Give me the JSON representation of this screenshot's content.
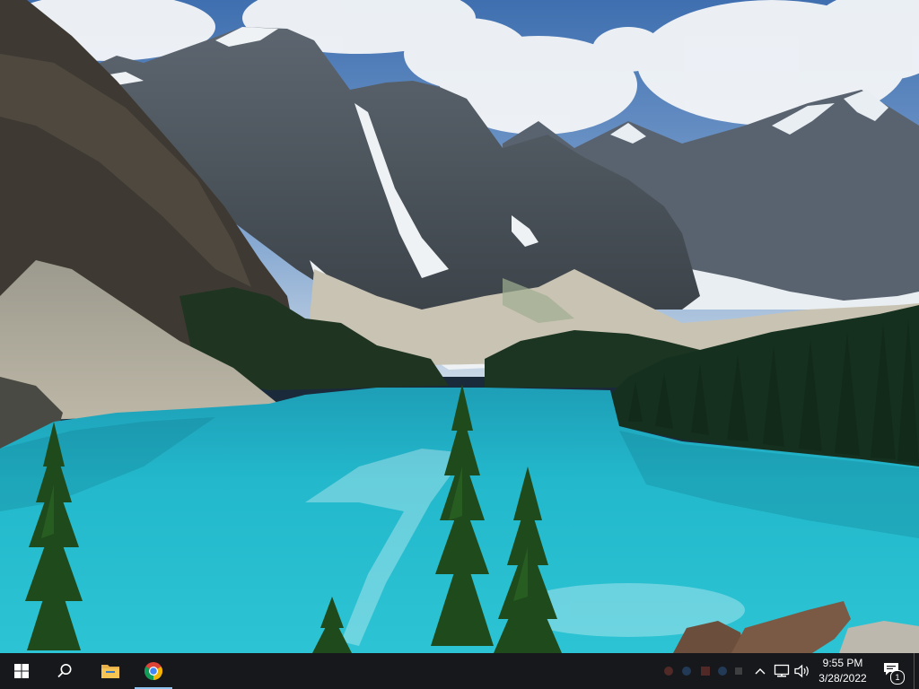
{
  "desktop": {
    "wallpaper": "mountain-lake-wallpaper"
  },
  "taskbar": {
    "background": "#16181c",
    "running_indicator_color": "#8ec3f0",
    "start_icon": "windows-logo-icon",
    "search_icon": "search-icon",
    "pinned": [
      {
        "icon": "file-explorer-icon",
        "running": false
      },
      {
        "icon": "chrome-icon",
        "running": true
      }
    ],
    "tray": {
      "icons": [
        "chevron-up-icon",
        "network-icon",
        "volume-icon"
      ],
      "time": "9:55 PM",
      "date": "3/28/2022",
      "notification_count": "1"
    }
  }
}
